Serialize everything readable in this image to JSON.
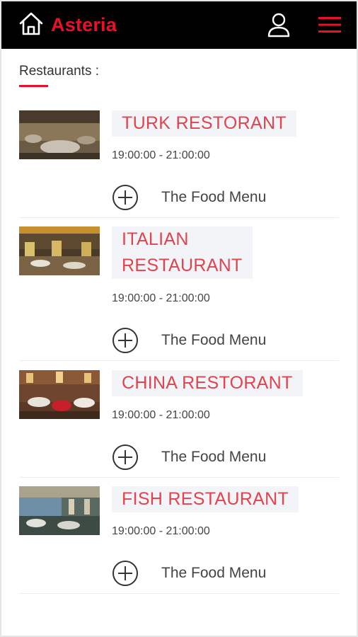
{
  "header": {
    "brand": "Asteria",
    "brand_color": "#e8102a",
    "background": "#000000",
    "icons": [
      "home-icon",
      "user-icon",
      "hamburger-menu-icon"
    ]
  },
  "section": {
    "title": "Restaurants :"
  },
  "restaurants": [
    {
      "name_line1": "TURK RESTORANT",
      "name_line2": "",
      "hours": "19:00:00 - 21:00:00",
      "menu_label": "The Food Menu"
    },
    {
      "name_line1": "ITALIAN",
      "name_line2": "RESTAURANT",
      "hours": "19:00:00 - 21:00:00",
      "menu_label": "The Food Menu"
    },
    {
      "name_line1": "CHINA RESTORANT",
      "name_line2": "",
      "hours": "19:00:00 - 21:00:00",
      "menu_label": "The Food Menu"
    },
    {
      "name_line1": "FISH RESTAURANT",
      "name_line2": "",
      "hours": "19:00:00 - 21:00:00",
      "menu_label": "The Food Menu"
    }
  ]
}
